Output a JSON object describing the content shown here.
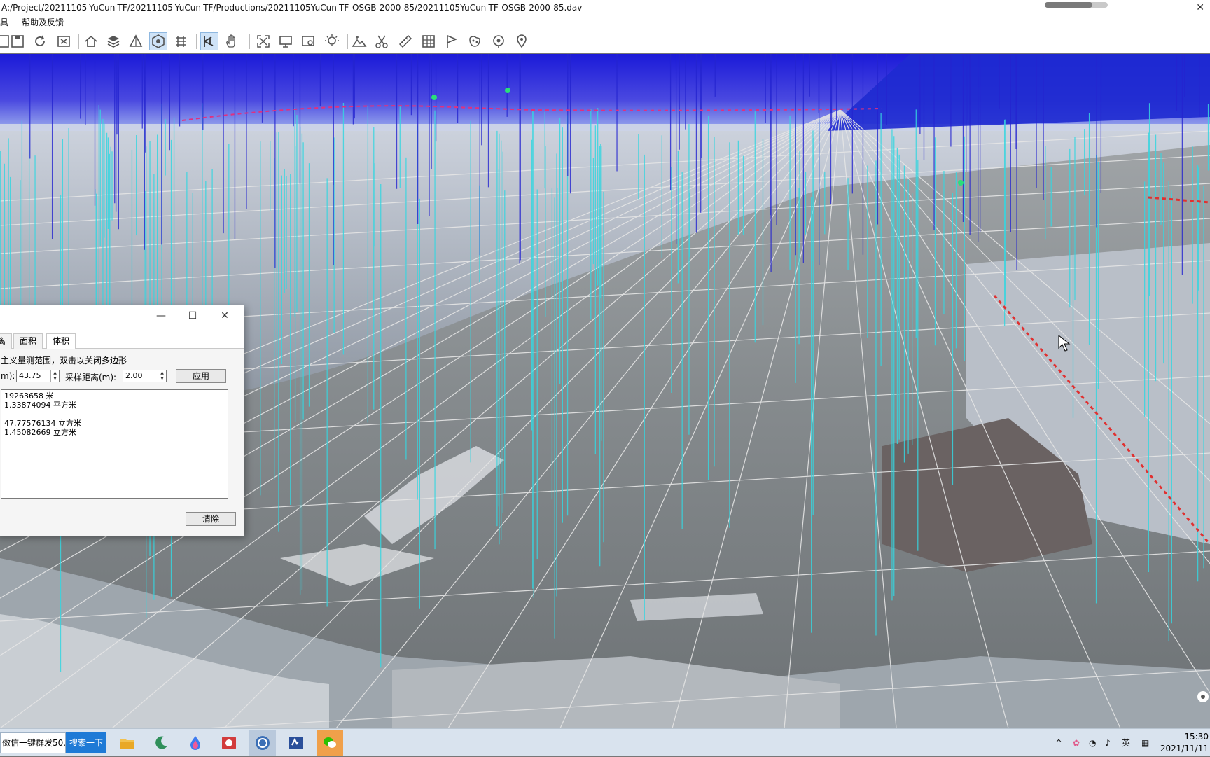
{
  "window": {
    "title": "A:/Project/20211105-YuCun-TF/20211105-YuCun-TF/Productions/20211105YuCun-TF-OSGB-2000-85/20211105YuCun-TF-OSGB-2000-85.dav",
    "progress_fraction": 0.75
  },
  "menu": {
    "item1": "工具",
    "item1_visible": "具",
    "item2": "帮助及反馈"
  },
  "toolbar": {
    "icons": [
      "new-icon",
      "save-icon",
      "refresh-icon",
      "export-icon",
      "home-icon",
      "layers-icon",
      "triangle-icon",
      "eye-icon",
      "grid-icon",
      "measure-icon",
      "hand-icon",
      "fullscreen-icon",
      "monitor-icon",
      "screenshot-icon",
      "light-icon",
      "terrain-icon",
      "scissors-icon",
      "ruler-icon",
      "table-icon",
      "flag-icon",
      "map-icon",
      "target-icon",
      "location-icon"
    ]
  },
  "dialog": {
    "tabs": [
      "距离",
      "面积",
      "体积"
    ],
    "tab0_visible": "离",
    "selected_tab": "体积",
    "hint": "定义量测范围，双击以关闭多边形",
    "hint_visible": "主义量测范围，双击以关闭多边形",
    "field1_label": "m):",
    "field1_value": "43.75",
    "field2_label": "采样距离(m):",
    "field2_value": "2.00",
    "apply_button": "应用",
    "clear_button": "清除",
    "results": [
      "19263658 米",
      "1.33874094 平方米",
      "",
      "47.77576134 立方米",
      "1.45082669 立方米"
    ]
  },
  "taskbar": {
    "search_text": "微信一键群发50...",
    "search_text_visible": "傚信一键群发50...",
    "search_button": "搜索一下",
    "apps": [
      "file-explorer-icon",
      "moon-app-icon",
      "paint-drop-icon",
      "weather-app-icon",
      "dav-viewer-icon",
      "sv-app-icon",
      "wechat-icon"
    ],
    "tray_chevron": "^",
    "ime": "英",
    "time": "15:30",
    "date": "2021/11/11"
  },
  "colors": {
    "accent_blue": "#1e7ad6",
    "red_dashed": "#e03030",
    "cyan_lines": "#36d6e0"
  }
}
